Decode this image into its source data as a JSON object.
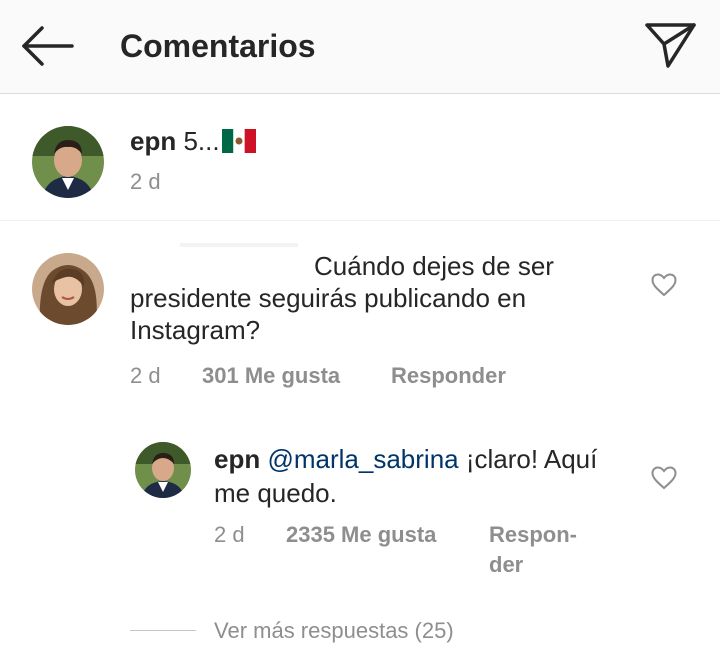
{
  "header": {
    "title": "Comentarios",
    "back_icon": "arrow-left-icon",
    "send_icon": "paper-plane-icon"
  },
  "caption": {
    "username": "epn",
    "text": "5...",
    "flag_icon": "mexico-flag-icon",
    "time": "2 d"
  },
  "comment": {
    "text": "Cuándo dejes de ser presidente seguirás publicando en Instagram?",
    "time": "2 d",
    "likes": "301 Me gusta",
    "reply_label": "Responder"
  },
  "reply": {
    "username": "epn",
    "mention": "@marla_sabrina",
    "text": "¡claro! Aquí me quedo.",
    "time": "2 d",
    "likes": "2335 Me gusta",
    "reply_label_1": "Respon-",
    "reply_label_2": "der"
  },
  "more_replies": "Ver más respuestas (25)",
  "colors": {
    "text": "#262626",
    "muted": "#8e8e8e",
    "mention": "#003569",
    "header_bg": "#fafafa"
  }
}
